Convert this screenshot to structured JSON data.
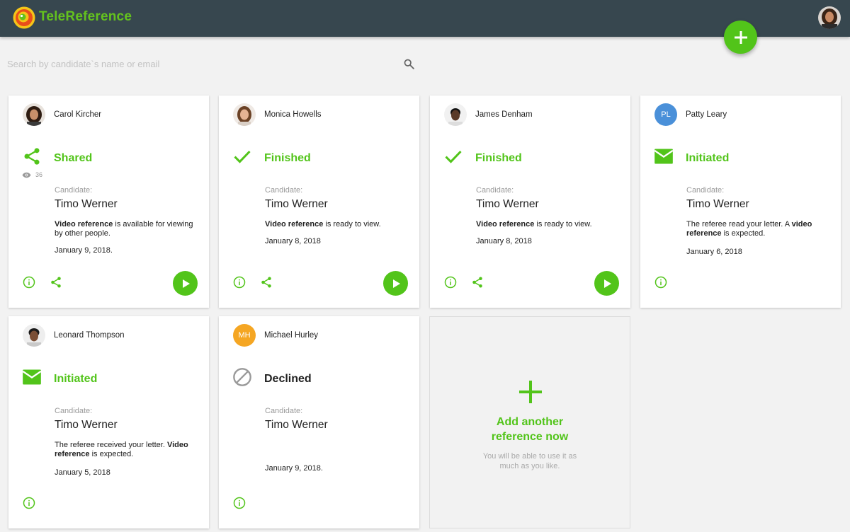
{
  "header": {
    "brand": "TeleReference",
    "add_button_icon": "plus-icon",
    "accent": "#52c41a",
    "bar_color": "#37474f"
  },
  "search": {
    "placeholder": "Search by candidate`s name or email",
    "value": ""
  },
  "cards": [
    {
      "referee": "Carol Kircher",
      "avatar": "photo",
      "status": "Shared",
      "status_icon": "share-icon",
      "views": "36",
      "candidate_label": "Candidate:",
      "candidate": "Timo Werner",
      "desc_bold": "Video reference",
      "desc_rest": " is available for viewing by other people.",
      "date": "January 9, 2018.",
      "actions": [
        "info-icon",
        "share-icon",
        "play-icon"
      ]
    },
    {
      "referee": "Monica Howells",
      "avatar": "photo",
      "status": "Finished",
      "status_icon": "check-icon",
      "candidate_label": "Candidate:",
      "candidate": "Timo Werner",
      "desc_bold": "Video reference",
      "desc_rest": " is ready to view.",
      "date": "January 8, 2018",
      "actions": [
        "info-icon",
        "share-icon",
        "play-icon"
      ]
    },
    {
      "referee": "James Denham",
      "avatar": "photo",
      "status": "Finished",
      "status_icon": "check-icon",
      "candidate_label": "Candidate:",
      "candidate": "Timo Werner",
      "desc_bold": "Video reference",
      "desc_rest": " is ready to view.",
      "date": "January 8, 2018",
      "actions": [
        "info-icon",
        "share-icon",
        "play-icon"
      ]
    },
    {
      "referee": "Patty Leary",
      "avatar_initials": "PL",
      "avatar_color": "#4a90d9",
      "status": "Initiated",
      "status_icon": "mail-icon",
      "candidate_label": "Candidate:",
      "candidate": "Timo Werner",
      "desc_pre": "The referee read your letter. A ",
      "desc_bold": "video reference",
      "desc_rest": " is expected.",
      "date": "January 6, 2018",
      "actions": [
        "info-icon"
      ]
    },
    {
      "referee": "Leonard Thompson",
      "avatar": "photo",
      "status": "Initiated",
      "status_icon": "mail-icon",
      "candidate_label": "Candidate:",
      "candidate": "Timo Werner",
      "desc_pre": "The referee received your letter. ",
      "desc_bold": "Video reference",
      "desc_rest": " is expected.",
      "date": "January 5, 2018",
      "actions": [
        "info-icon"
      ]
    },
    {
      "referee": "Michael Hurley",
      "avatar_initials": "MH",
      "avatar_color": "#f5a623",
      "status": "Declined",
      "status_icon": "block-icon",
      "candidate_label": "Candidate:",
      "candidate": "Timo Werner",
      "date": "January 9, 2018.",
      "actions": [
        "info-icon"
      ]
    }
  ],
  "add_card": {
    "title": "Add another reference now",
    "subtitle": "You will be able to use it as much as you like."
  }
}
